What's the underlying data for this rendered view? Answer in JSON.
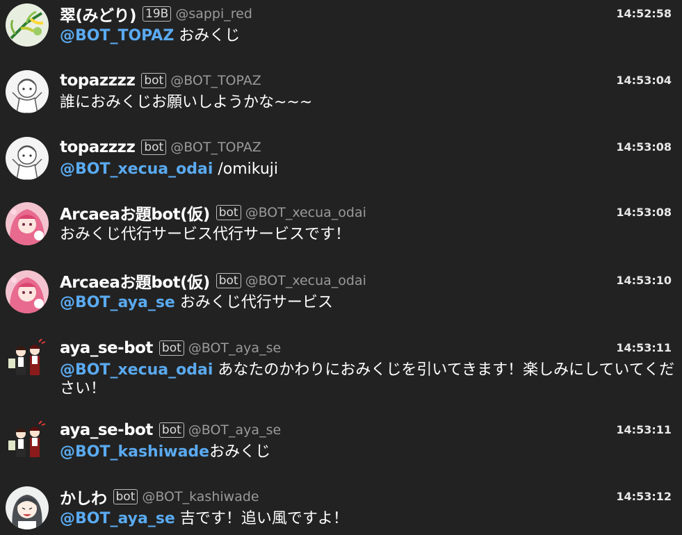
{
  "colors": {
    "background": "#222222",
    "mention": "#5aaaf0",
    "handle": "#9a9a9a",
    "text": "#ffffff"
  },
  "messages": [
    {
      "name": "翠(みどり)",
      "badge": "19B",
      "handle": "@sappi_red",
      "time": "14:52:58",
      "mention": "@BOT_TOPAZ",
      "text": " おみくじ",
      "avatar_icon": "green-plant-avatar"
    },
    {
      "name": "topazzzz",
      "badge": "bot",
      "handle": "@BOT_TOPAZ",
      "time": "14:53:04",
      "mention": "",
      "text": "誰におみくじお願いしようかな~~~",
      "avatar_icon": "sketch-character-avatar"
    },
    {
      "name": "topazzzz",
      "badge": "bot",
      "handle": "@BOT_TOPAZ",
      "time": "14:53:08",
      "mention": "@BOT_xecua_odai",
      "text": " /omikuji",
      "avatar_icon": "sketch-character-avatar"
    },
    {
      "name": "Arcaeaお題bot(仮)",
      "badge": "bot",
      "handle": "@BOT_xecua_odai",
      "time": "14:53:08",
      "mention": "",
      "text": "おみくじ代行サービス代行サービスです！",
      "avatar_icon": "pink-anime-avatar"
    },
    {
      "name": "Arcaeaお題bot(仮)",
      "badge": "bot",
      "handle": "@BOT_xecua_odai",
      "time": "14:53:10",
      "mention": "@BOT_aya_se",
      "text": " おみくじ代行サービス",
      "avatar_icon": "pink-anime-avatar"
    },
    {
      "name": "aya_se-bot",
      "badge": "bot",
      "handle": "@BOT_aya_se",
      "time": "14:53:11",
      "mention": "@BOT_xecua_odai",
      "text": " あなたのかわりにおみくじを引いてきます！楽しみにしていてください！",
      "avatar_icon": "maids-avatar"
    },
    {
      "name": "aya_se-bot",
      "badge": "bot",
      "handle": "@BOT_aya_se",
      "time": "14:53:11",
      "mention": "@BOT_kashiwade",
      "text": "おみくじ",
      "avatar_icon": "maids-avatar"
    },
    {
      "name": "かしわ",
      "badge": "bot",
      "handle": "@BOT_kashiwade",
      "time": "14:53:12",
      "mention": "@BOT_aya_se",
      "text": " 吉です！追い風ですよ！",
      "avatar_icon": "anime-girl-avatar"
    }
  ]
}
